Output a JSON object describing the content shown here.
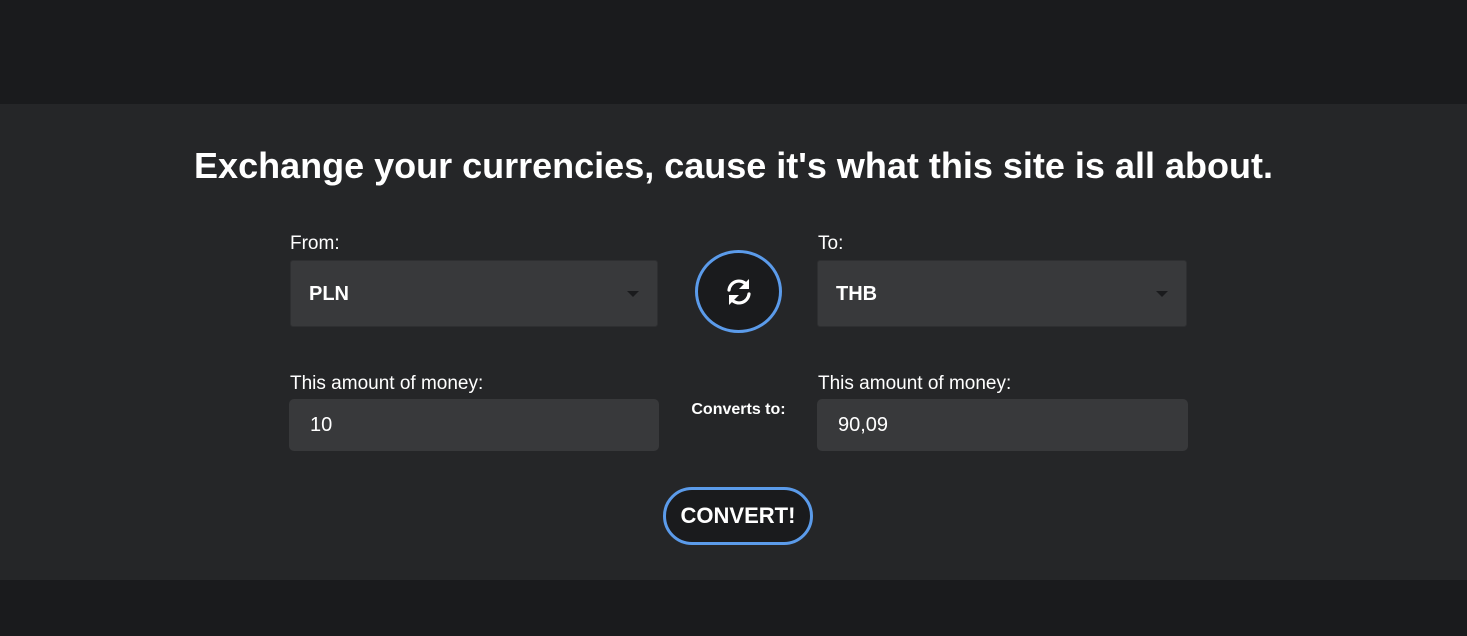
{
  "header": {
    "title": "Exchange your currencies, cause it's what this site is all about."
  },
  "from": {
    "label": "From:",
    "selected_currency": "PLN"
  },
  "to": {
    "label": "To:",
    "selected_currency": "THB"
  },
  "swap": {
    "icon": "swap-arrows-icon"
  },
  "from_amount": {
    "label": "This amount of money:",
    "value": "10"
  },
  "converts_to": {
    "label": "Converts to:"
  },
  "to_amount": {
    "label": "This amount of money:",
    "value": "90,09"
  },
  "convert_button": {
    "label": "CONVERT!"
  },
  "colors": {
    "page_background": "#1a1b1d",
    "panel_background": "#252628",
    "field_background": "#38393b",
    "accent_border": "#5b9bea",
    "text": "#ffffff"
  }
}
